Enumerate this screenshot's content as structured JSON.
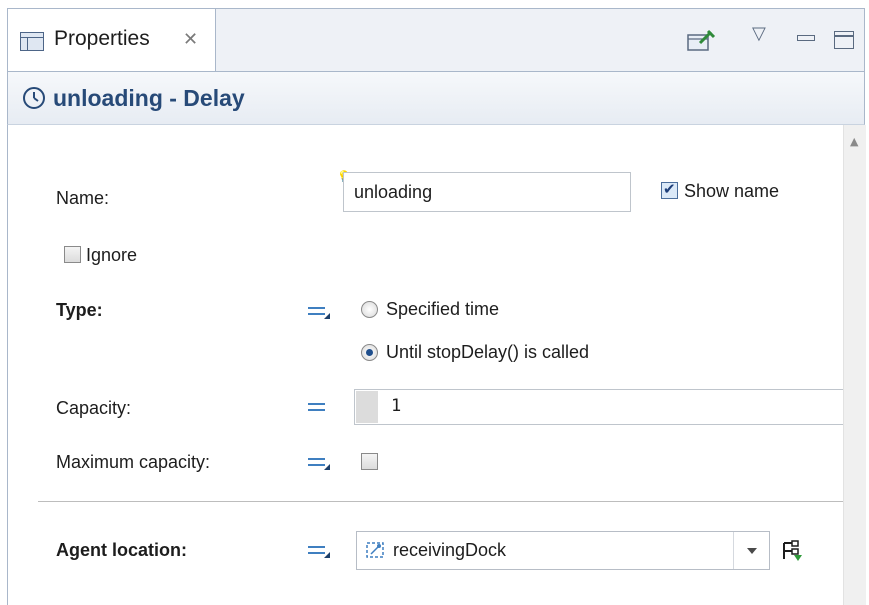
{
  "tab": {
    "label": "Properties",
    "close_glyph": "✕"
  },
  "header": {
    "title": "unloading - Delay",
    "icon": "clock-icon"
  },
  "form": {
    "name_label": "Name:",
    "name_value": "unloading",
    "show_name_label": "Show name",
    "show_name_checked": true,
    "ignore_label": "Ignore",
    "ignore_checked": false,
    "type_label": "Type:",
    "type_options": [
      {
        "label": "Specified time",
        "selected": false
      },
      {
        "label": "Until stopDelay() is called",
        "selected": true
      }
    ],
    "capacity_label": "Capacity:",
    "capacity_value": "1",
    "max_capacity_label": "Maximum capacity:",
    "max_capacity_checked": false,
    "agent_location_label": "Agent location:",
    "agent_location_value": "receivingDock"
  },
  "colors": {
    "header_title": "#274a78",
    "equals_icon": "#3f7fc0",
    "tab_border": "#a9b7ca"
  }
}
